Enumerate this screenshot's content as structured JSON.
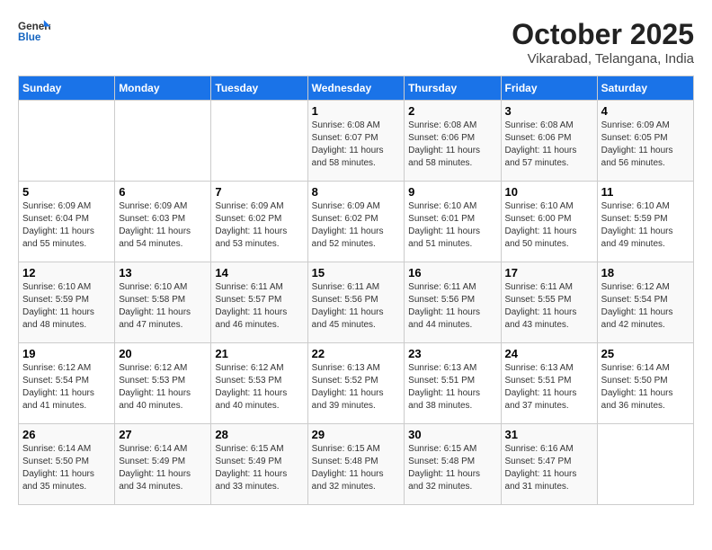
{
  "header": {
    "logo_general": "General",
    "logo_blue": "Blue",
    "month_title": "October 2025",
    "location": "Vikarabad, Telangana, India"
  },
  "days_of_week": [
    "Sunday",
    "Monday",
    "Tuesday",
    "Wednesday",
    "Thursday",
    "Friday",
    "Saturday"
  ],
  "weeks": [
    [
      {
        "day": "",
        "info": ""
      },
      {
        "day": "",
        "info": ""
      },
      {
        "day": "",
        "info": ""
      },
      {
        "day": "1",
        "info": "Sunrise: 6:08 AM\nSunset: 6:07 PM\nDaylight: 11 hours\nand 58 minutes."
      },
      {
        "day": "2",
        "info": "Sunrise: 6:08 AM\nSunset: 6:06 PM\nDaylight: 11 hours\nand 58 minutes."
      },
      {
        "day": "3",
        "info": "Sunrise: 6:08 AM\nSunset: 6:06 PM\nDaylight: 11 hours\nand 57 minutes."
      },
      {
        "day": "4",
        "info": "Sunrise: 6:09 AM\nSunset: 6:05 PM\nDaylight: 11 hours\nand 56 minutes."
      }
    ],
    [
      {
        "day": "5",
        "info": "Sunrise: 6:09 AM\nSunset: 6:04 PM\nDaylight: 11 hours\nand 55 minutes."
      },
      {
        "day": "6",
        "info": "Sunrise: 6:09 AM\nSunset: 6:03 PM\nDaylight: 11 hours\nand 54 minutes."
      },
      {
        "day": "7",
        "info": "Sunrise: 6:09 AM\nSunset: 6:02 PM\nDaylight: 11 hours\nand 53 minutes."
      },
      {
        "day": "8",
        "info": "Sunrise: 6:09 AM\nSunset: 6:02 PM\nDaylight: 11 hours\nand 52 minutes."
      },
      {
        "day": "9",
        "info": "Sunrise: 6:10 AM\nSunset: 6:01 PM\nDaylight: 11 hours\nand 51 minutes."
      },
      {
        "day": "10",
        "info": "Sunrise: 6:10 AM\nSunset: 6:00 PM\nDaylight: 11 hours\nand 50 minutes."
      },
      {
        "day": "11",
        "info": "Sunrise: 6:10 AM\nSunset: 5:59 PM\nDaylight: 11 hours\nand 49 minutes."
      }
    ],
    [
      {
        "day": "12",
        "info": "Sunrise: 6:10 AM\nSunset: 5:59 PM\nDaylight: 11 hours\nand 48 minutes."
      },
      {
        "day": "13",
        "info": "Sunrise: 6:10 AM\nSunset: 5:58 PM\nDaylight: 11 hours\nand 47 minutes."
      },
      {
        "day": "14",
        "info": "Sunrise: 6:11 AM\nSunset: 5:57 PM\nDaylight: 11 hours\nand 46 minutes."
      },
      {
        "day": "15",
        "info": "Sunrise: 6:11 AM\nSunset: 5:56 PM\nDaylight: 11 hours\nand 45 minutes."
      },
      {
        "day": "16",
        "info": "Sunrise: 6:11 AM\nSunset: 5:56 PM\nDaylight: 11 hours\nand 44 minutes."
      },
      {
        "day": "17",
        "info": "Sunrise: 6:11 AM\nSunset: 5:55 PM\nDaylight: 11 hours\nand 43 minutes."
      },
      {
        "day": "18",
        "info": "Sunrise: 6:12 AM\nSunset: 5:54 PM\nDaylight: 11 hours\nand 42 minutes."
      }
    ],
    [
      {
        "day": "19",
        "info": "Sunrise: 6:12 AM\nSunset: 5:54 PM\nDaylight: 11 hours\nand 41 minutes."
      },
      {
        "day": "20",
        "info": "Sunrise: 6:12 AM\nSunset: 5:53 PM\nDaylight: 11 hours\nand 40 minutes."
      },
      {
        "day": "21",
        "info": "Sunrise: 6:12 AM\nSunset: 5:53 PM\nDaylight: 11 hours\nand 40 minutes."
      },
      {
        "day": "22",
        "info": "Sunrise: 6:13 AM\nSunset: 5:52 PM\nDaylight: 11 hours\nand 39 minutes."
      },
      {
        "day": "23",
        "info": "Sunrise: 6:13 AM\nSunset: 5:51 PM\nDaylight: 11 hours\nand 38 minutes."
      },
      {
        "day": "24",
        "info": "Sunrise: 6:13 AM\nSunset: 5:51 PM\nDaylight: 11 hours\nand 37 minutes."
      },
      {
        "day": "25",
        "info": "Sunrise: 6:14 AM\nSunset: 5:50 PM\nDaylight: 11 hours\nand 36 minutes."
      }
    ],
    [
      {
        "day": "26",
        "info": "Sunrise: 6:14 AM\nSunset: 5:50 PM\nDaylight: 11 hours\nand 35 minutes."
      },
      {
        "day": "27",
        "info": "Sunrise: 6:14 AM\nSunset: 5:49 PM\nDaylight: 11 hours\nand 34 minutes."
      },
      {
        "day": "28",
        "info": "Sunrise: 6:15 AM\nSunset: 5:49 PM\nDaylight: 11 hours\nand 33 minutes."
      },
      {
        "day": "29",
        "info": "Sunrise: 6:15 AM\nSunset: 5:48 PM\nDaylight: 11 hours\nand 32 minutes."
      },
      {
        "day": "30",
        "info": "Sunrise: 6:15 AM\nSunset: 5:48 PM\nDaylight: 11 hours\nand 32 minutes."
      },
      {
        "day": "31",
        "info": "Sunrise: 6:16 AM\nSunset: 5:47 PM\nDaylight: 11 hours\nand 31 minutes."
      },
      {
        "day": "",
        "info": ""
      }
    ]
  ]
}
